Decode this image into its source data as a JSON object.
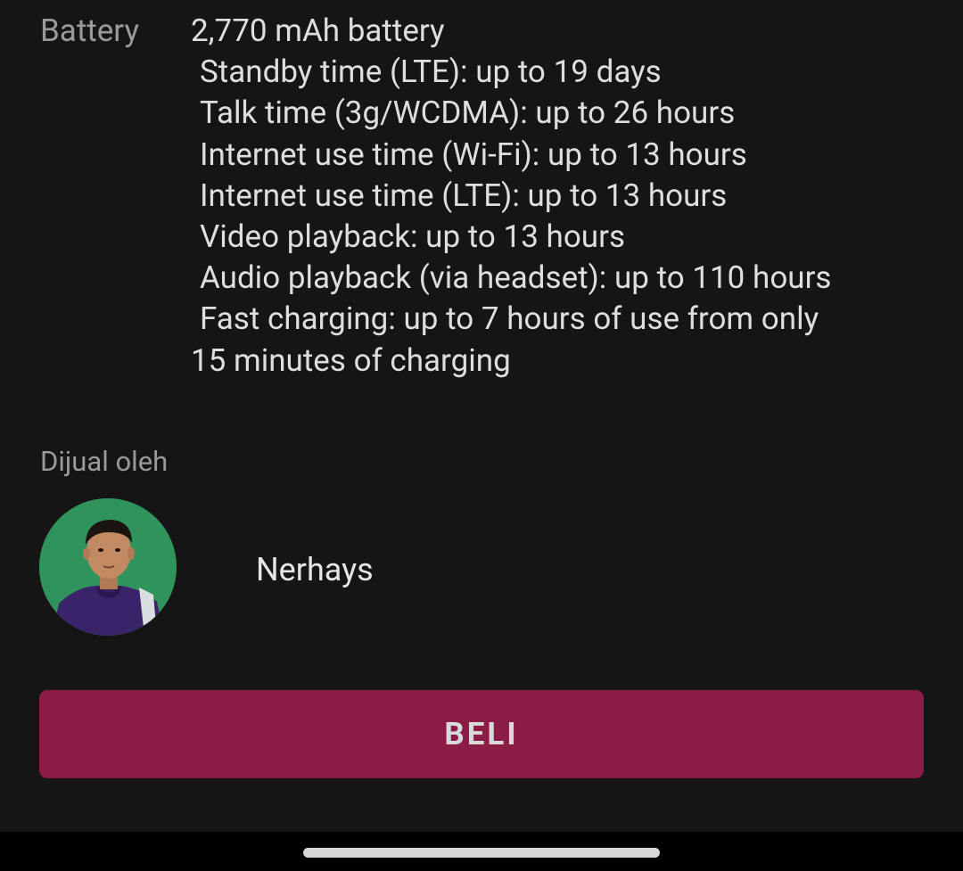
{
  "specs": {
    "battery_label": "Battery",
    "battery_lines": [
      "2,770 mAh battery",
      "Standby time (LTE): up to 19 days",
      "Talk time (3g/WCDMA): up to 26 hours",
      "Internet use time (Wi-Fi): up to 13 hours",
      "Internet use time (LTE): up to 13 hours",
      "Video playback: up to 13 hours",
      "Audio playback (via headset): up to 110 hours",
      "Fast charging: up to 7 hours of use from only",
      "15 minutes of charging"
    ]
  },
  "seller": {
    "section_label": "Dijual oleh",
    "name": "Nerhays",
    "avatar_icon": "seller-avatar-photo"
  },
  "actions": {
    "buy_label": "BELI"
  },
  "colors": {
    "background": "#151515",
    "buy_button": "#8b1c45",
    "label_text": "#9a9a9a",
    "value_text": "#dedede"
  }
}
